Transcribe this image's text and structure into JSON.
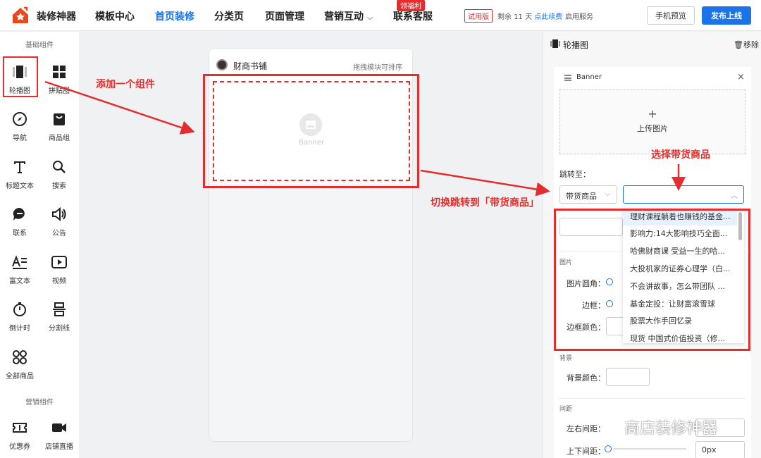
{
  "topbar": {
    "brand": "装修神器",
    "nav": [
      "模板中心",
      "首页装修",
      "分类页",
      "页面管理",
      "营销互动",
      "联系客服"
    ],
    "nav_marketing_chevron": "⌵",
    "welfare_badge": "领福利",
    "trial_badge": "试用版",
    "remaining_prefix": "剩余 11 天",
    "renew_link": "点此续费",
    "service_link": "启用服务",
    "preview_button": "手机预览",
    "publish_button": "发布上线",
    "colors": {
      "brand": "#1a73e8",
      "accent": "#e52d2d"
    }
  },
  "sidebar": {
    "section_basic": "基础组件",
    "components": [
      {
        "label": "轮播图",
        "icon": "carousel-icon"
      },
      {
        "label": "拼贴图",
        "icon": "grid-icon"
      },
      {
        "label": "导航",
        "icon": "compass-icon"
      },
      {
        "label": "商品组",
        "icon": "shopping-bag-icon"
      },
      {
        "label": "标题文本",
        "icon": "text-icon"
      },
      {
        "label": "搜索",
        "icon": "search-icon"
      },
      {
        "label": "联系",
        "icon": "chat-icon"
      },
      {
        "label": "公告",
        "icon": "speaker-icon"
      },
      {
        "label": "富文本",
        "icon": "rich-text-icon"
      },
      {
        "label": "视频",
        "icon": "play-icon"
      },
      {
        "label": "倒计时",
        "icon": "timer-icon"
      },
      {
        "label": "分割线",
        "icon": "divider-icon"
      },
      {
        "label": "全部商品",
        "icon": "all-products-icon"
      }
    ],
    "section_marketing": "营销组件",
    "marketing": [
      {
        "label": "优惠券",
        "icon": "coupon-icon"
      },
      {
        "label": "店铺直播",
        "icon": "video-camera-icon"
      }
    ]
  },
  "canvas": {
    "shop_name": "财商书铺",
    "drag_hint": "拖拽模块可排序",
    "banner_placeholder": "Banner"
  },
  "panel": {
    "title": "轮播图",
    "remove": "移除",
    "card_title": "Banner",
    "close": "×",
    "upload_plus": "+",
    "upload_label": "上传图片",
    "jump_label": "跳转至：",
    "jump_type": "带货商品",
    "jump_chevron": "⌵",
    "dropdown_chevron": "︿",
    "dropdown_items": [
      "理财课程躺着也赚钱的基金...",
      "影响力:14大影响技巧全面...",
      "哈佛财商课 受益一生的哈...",
      "大投机家的证券心理学（白...",
      "不会讲故事，怎么带团队 ...",
      "基金定投：让财富滚雪球",
      "股票大作手回忆录",
      "现货 中国式价值投资（修..."
    ],
    "section_image": "图片",
    "corner_label": "图片圆角：",
    "border_label": "边框：",
    "border_color_label": "边框颜色：",
    "section_bg": "背景",
    "bg_color_label": "背景颜色：",
    "section_spacing": "间距",
    "lr_spacing_label": "左右间距：",
    "tb_spacing_label": "上下间距：",
    "tb_spacing_value": "0px"
  },
  "annotations": {
    "add_component": "添加一个组件",
    "switch_jump": "切换跳转到「带货商品」",
    "select_product": "选择带货商品"
  },
  "watermark": "商店装修神器"
}
